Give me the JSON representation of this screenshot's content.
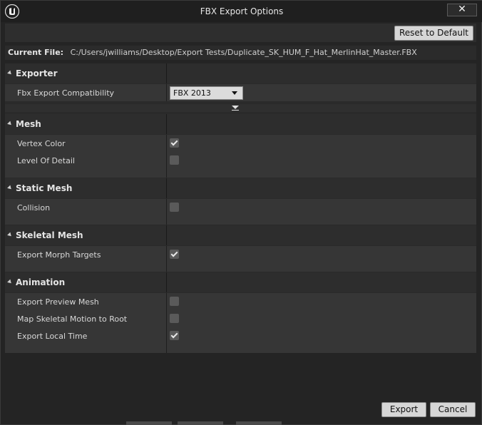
{
  "window": {
    "title": "FBX Export Options",
    "close_label": "✕"
  },
  "toolbar": {
    "reset_label": "Reset to Default"
  },
  "current_file": {
    "label": "Current File:",
    "path": "C:/Users/jwilliams/Desktop/Export Tests/Duplicate_SK_HUM_F_Hat_MerlinHat_Master.FBX"
  },
  "sections": {
    "exporter": {
      "title": "Exporter",
      "fbx_compat_label": "Fbx Export Compatibility",
      "fbx_compat_value": "FBX 2013"
    },
    "mesh": {
      "title": "Mesh",
      "vertex_color_label": "Vertex Color",
      "vertex_color_checked": true,
      "lod_label": "Level Of Detail",
      "lod_checked": false
    },
    "static_mesh": {
      "title": "Static Mesh",
      "collision_label": "Collision",
      "collision_checked": false
    },
    "skeletal_mesh": {
      "title": "Skeletal Mesh",
      "morph_label": "Export Morph Targets",
      "morph_checked": true
    },
    "animation": {
      "title": "Animation",
      "preview_label": "Export Preview Mesh",
      "preview_checked": false,
      "map_root_label": "Map Skeletal Motion to Root",
      "map_root_checked": false,
      "local_time_label": "Export Local Time",
      "local_time_checked": true
    }
  },
  "footer": {
    "export_label": "Export",
    "cancel_label": "Cancel"
  },
  "icons": {
    "logo": "unreal-engine-logo-icon",
    "advanced": "advanced-expand-icon"
  }
}
